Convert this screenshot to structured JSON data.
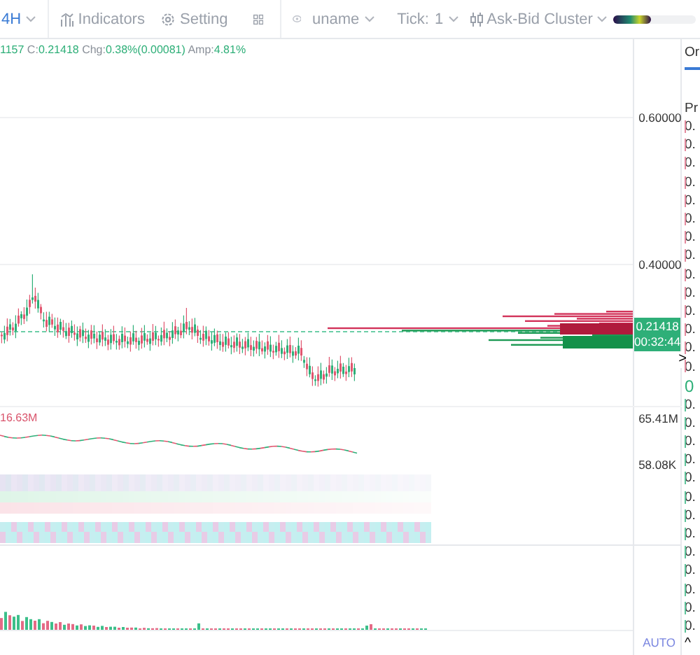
{
  "toolbar": {
    "interval": "4H",
    "indicators": "Indicators",
    "setting": "Setting",
    "user": "uname",
    "tick_label": "Tick:",
    "tick_value": "1",
    "cluster": "Ask-Bid Cluster"
  },
  "legend": [
    {
      "kind": "value",
      "text": "1157"
    },
    {
      "kind": "label",
      "text": "C:"
    },
    {
      "kind": "value",
      "text": "0.21418"
    },
    {
      "kind": "label",
      "text": "Chg:"
    },
    {
      "kind": "value",
      "text": "0.38%(0.00081)"
    },
    {
      "kind": "label",
      "text": "Amp:"
    },
    {
      "kind": "value",
      "text": "4.81%"
    }
  ],
  "price_axis": {
    "ticks": [
      "0.60000",
      "0.40000"
    ],
    "last_price": "0.21418",
    "countdown": "00:32:44"
  },
  "volume_pane": {
    "label": "16.63M",
    "axis": [
      "65.41M",
      "58.08K"
    ]
  },
  "footer": {
    "scale_mode": "AUTO"
  },
  "order_panel": {
    "tab": "Or",
    "header": "Pr",
    "asks": [
      "0.",
      "0.",
      "0.",
      "0.",
      "0.",
      "0.",
      "0.",
      "0.",
      "0.",
      "0.",
      "0.",
      "0.",
      "0.",
      "0."
    ],
    "mid": "0",
    "bids": [
      "0.",
      "0.",
      "0.",
      "0.",
      "0.",
      "0.",
      "0.",
      "0.",
      "0.",
      "0.",
      "0.",
      "0.",
      "0."
    ],
    "expand": ">",
    "collapse": "^"
  }
}
